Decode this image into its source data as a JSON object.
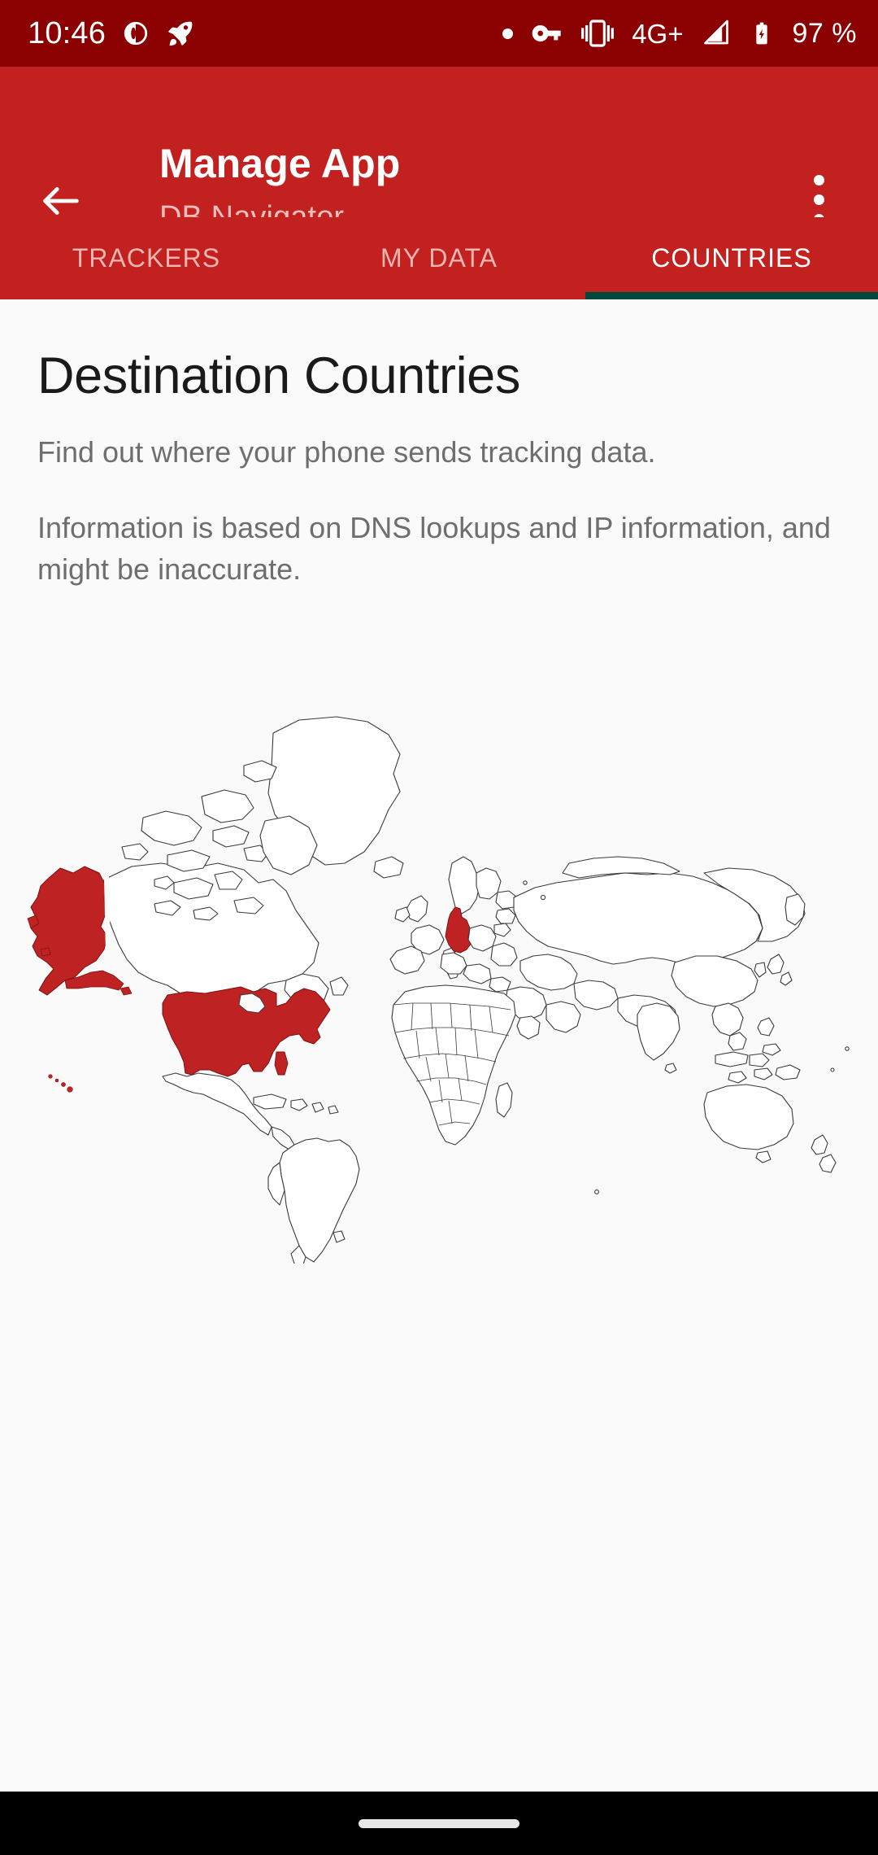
{
  "status_bar": {
    "time": "10:46",
    "icons_left": [
      "contrast-circle-icon",
      "rocket-icon"
    ],
    "icons_right": [
      "dot-indicator-icon",
      "vpn-key-icon",
      "vibrate-icon"
    ],
    "network_type": "4G+",
    "signal_icon": "signal-cellular-icon",
    "battery_icon": "battery-charging-icon",
    "battery_level": "97 %",
    "background_color": "#8B0000",
    "foreground_color": "#FFFFFF"
  },
  "app_bar": {
    "back_icon": "arrow-back-icon",
    "title": "Manage App",
    "subtitle": "DB Navigator",
    "overflow_icon": "more-vert-icon",
    "background_color": "#C2211F",
    "title_color": "#FFFFFF",
    "subtitle_color": "#F2BDBA"
  },
  "tabs": {
    "active_index": 2,
    "indicator_color": "#00483C",
    "active_label_color": "#FFFFFF",
    "inactive_label_color": "#F0B5B1",
    "items": [
      {
        "label": "TRACKERS",
        "active": false
      },
      {
        "label": "MY DATA",
        "active": false
      },
      {
        "label": "COUNTRIES",
        "active": true
      }
    ]
  },
  "main": {
    "heading": "Destination Countries",
    "subheading": "Find out where your phone sends tracking data.",
    "note": "Information is based on DNS lookups and IP information, and might be inaccurate.",
    "background_color": "#FAFAFA",
    "heading_color": "#1A1A1A",
    "body_color": "#6E6E6E"
  },
  "map": {
    "type": "choropleth-world-map",
    "projection": "equirectangular",
    "highlight_color": "#BF2222",
    "outline_color": "#3A3A3A",
    "land_fill": "#FFFFFF",
    "background": "#FAFAFA",
    "highlighted_countries": [
      "United States",
      "Germany"
    ],
    "highlighted_regions": [
      "United States (contiguous)",
      "Alaska",
      "Hawaii",
      "Germany"
    ]
  },
  "nav_bar": {
    "handle": "gesture-home-handle",
    "background_color": "#000000",
    "handle_color": "#E8E8E8"
  }
}
